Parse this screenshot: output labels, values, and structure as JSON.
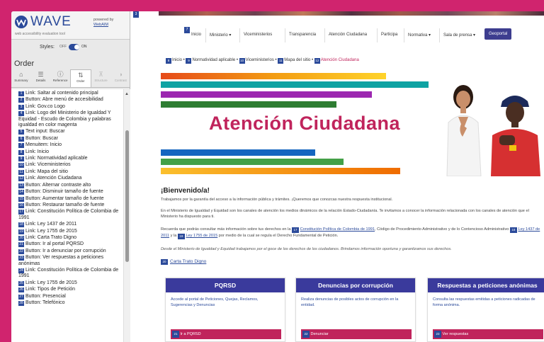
{
  "wave": {
    "title": "WAVE",
    "tagline": "web accessibility evaluation tool",
    "powered_by": "powered by",
    "powered_link": "WebAIM",
    "styles_label": "Styles:",
    "toggle_off": "OFF",
    "toggle_on": "ON",
    "panel_title": "Order",
    "tabs": [
      {
        "label": "Summary",
        "icon": "home-icon",
        "glyph": "⌂"
      },
      {
        "label": "Details",
        "icon": "list-icon",
        "glyph": "☰"
      },
      {
        "label": "Reference",
        "icon": "info-icon",
        "glyph": "ⓘ"
      },
      {
        "label": "Order",
        "icon": "order-icon",
        "glyph": "⇅"
      },
      {
        "label": "Structure",
        "icon": "structure-icon",
        "glyph": "⊼"
      },
      {
        "label": "Contrast",
        "icon": "contrast-icon",
        "glyph": "◑"
      }
    ],
    "order_items": [
      {
        "n": "1",
        "text": "Link: Saltar al contenido principal"
      },
      {
        "n": "2",
        "text": "Button: Abre menú de accesibilidad"
      },
      {
        "n": "3",
        "text": "Link: Gov.co Logo"
      },
      {
        "n": "4",
        "text": "Link: Logo del Ministerio de Igualdad Y Equidad - Escudo de Colombia y palabras igualdad en color magenta"
      },
      {
        "n": "5",
        "text": "Text input: Buscar"
      },
      {
        "n": "6",
        "text": "Button: Buscar"
      },
      {
        "n": "7",
        "text": "Menuitem: Inicio"
      },
      {
        "n": "8",
        "text": "Link: Inicio"
      },
      {
        "n": "9",
        "text": "Link: Normatividad aplicable"
      },
      {
        "n": "10",
        "text": "Link: Viceministerios"
      },
      {
        "n": "11",
        "text": "Link: Mapa del sitio"
      },
      {
        "n": "12",
        "text": "Link: Atención Ciudadana"
      },
      {
        "n": "13",
        "text": "Button: Alternar contraste alto"
      },
      {
        "n": "14",
        "text": "Button: Disminuir tamaño de fuente"
      },
      {
        "n": "15",
        "text": "Button: Aumentar tamaño de fuente"
      },
      {
        "n": "16",
        "text": "Button: Restaurar tamaño de fuente"
      },
      {
        "n": "17",
        "text": "Link: Constitución Política de Colombia de 1991"
      },
      {
        "n": "18",
        "text": "Link: Ley 1437 de 2011"
      },
      {
        "n": "19",
        "text": "Link: Ley 1755 de 2015"
      },
      {
        "n": "20",
        "text": "Link: Carta Trato Digno"
      },
      {
        "n": "21",
        "text": "Button: Ir al portal PQRSD"
      },
      {
        "n": "22",
        "text": "Button: Ir a denunciar por corrupción"
      },
      {
        "n": "23",
        "text": "Button: Ver respuestas a peticiones anónimas"
      },
      {
        "n": "24",
        "text": "Link: Constitución Política de Colombia de 1991"
      },
      {
        "n": "25",
        "text": "Link: Ley 1755 de 2015"
      },
      {
        "n": "26",
        "text": "Link: Tipos de Petición"
      },
      {
        "n": "27",
        "text": "Button: Presencial"
      },
      {
        "n": "28",
        "text": "Button: Telefónico"
      }
    ]
  },
  "nav": {
    "items": [
      "Inicio",
      "Ministerio",
      "Viceministerios",
      "Transparencia",
      "Atención Ciudadana",
      "Participa",
      "Normativa",
      "Sala de prensa",
      "Geoportal"
    ],
    "marker": "7",
    "top_marker": "3"
  },
  "breadcrumb": {
    "items": [
      {
        "n": "8",
        "text": "Inicio"
      },
      {
        "n": "9",
        "text": "Normatividad aplicable"
      },
      {
        "n": "10",
        "text": "Viceministerios"
      },
      {
        "n": "11",
        "text": "Mapa del sitio"
      },
      {
        "n": "12",
        "text": "Atención Ciudadana"
      }
    ]
  },
  "hero": {
    "title": "Atención Ciudadana"
  },
  "content": {
    "welcome": "¡Bienvenido/a!",
    "p1": "Trabajamos por la garantía del acceso a la información pública y trámites. ¡Queremos que conozcas nuestra respuesta institucional.",
    "p2": "En el Ministerio de Igualdad y Equidad son los canales de atención los medios dinámicos de la relación Estado-Ciudadanía. Te invitamos a conocer la información relacionada con los canales de atención que el Ministerio ha dispuesto para ti.",
    "p3a": "Recuerda que podrás consultar más información sobre tus derechos en la",
    "p3_m1": "17",
    "p3_link1": "Constitución Política de Colombia de 1991",
    "p3b": ", Código de Procedimiento Administrativo y de lo Contencioso Administrativo",
    "p3_m2": "18",
    "p3_link2": "Ley 1437 de 2011",
    "p3c": "y la",
    "p3_m3": "19",
    "p3_link3": "Ley 1755 de 2015",
    "p3d": "por medio de la cual se regula el Derecho Fundamental de Petición.",
    "p4": "Desde el Ministerio de Igualdad y Equidad trabajamos por el goce de los derechos de los ciudadanos. Brindamos información oportuna y garantizamos sus derechos.",
    "carta_marker": "20",
    "carta": "Carta Trato Digno"
  },
  "cards": [
    {
      "title": "PQRSD",
      "body": "Accede al portal de Peticiones, Quejas, Reclamos, Sugerencias y Denuncias",
      "marker": "21",
      "button": "Ir a PQRSD"
    },
    {
      "title": "Denuncias por corrupción",
      "body": "Realiza denuncias de posibles actos de corrupción en la entidad.",
      "marker": "22",
      "button": "Denunciar"
    },
    {
      "title": "Respuestas a peticiones anónimas",
      "body": "Consulta las respuestas emitidas a peticiones radicadas de forma anónima.",
      "marker": "23",
      "button": "Ver respuestas"
    }
  ],
  "colors": {
    "frame": "#d0246e",
    "wave_blue": "#2b4a9a",
    "magenta": "#c0245c",
    "nav_active": "#3d3d8f",
    "card_head": "#3a3a9c"
  }
}
